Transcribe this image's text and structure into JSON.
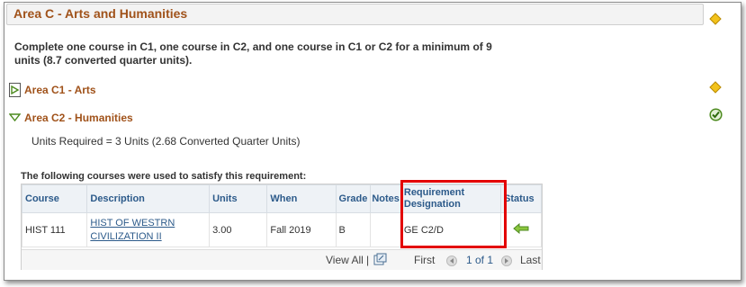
{
  "area": {
    "title": "Area C - Arts and Humanities",
    "description": "Complete one course in C1, one course in C2, and one course in C1 or C2 for a minimum of 9 units (8.7 converted quarter units)."
  },
  "subareas": [
    {
      "title": "Area C1 - Arts",
      "expanded": false,
      "status_icon": "diamond-icon"
    },
    {
      "title": "Area C2 - Humanities",
      "expanded": true,
      "status_icon": "check-circle-icon"
    }
  ],
  "c2": {
    "units_required": "Units Required = 3 Units (2.68 Converted Quarter Units)",
    "courses_caption": "The following courses were used to satisfy this requirement:",
    "columns": [
      "Course",
      "Description",
      "Units",
      "When",
      "Grade",
      "Notes",
      "Requirement Designation",
      "Status"
    ],
    "rows": [
      {
        "course": "HIST 111",
        "description": "HIST OF WESTRN CIVILIZATION II",
        "units": "3.00",
        "when": "Fall 2019",
        "grade": "B",
        "notes": "",
        "requirement_designation": "GE C2/D",
        "status_icon": "green-arrow-left-icon"
      }
    ],
    "footer": {
      "view_all": "View All",
      "separator": "|",
      "first": "First",
      "range": "1 of 1",
      "last": "Last"
    }
  },
  "colors": {
    "title": "#a0521a",
    "header_link": "#2c5a8a",
    "diamond": "#f2c21b",
    "check": "#4c8a1e",
    "highlight": "#e30000"
  }
}
